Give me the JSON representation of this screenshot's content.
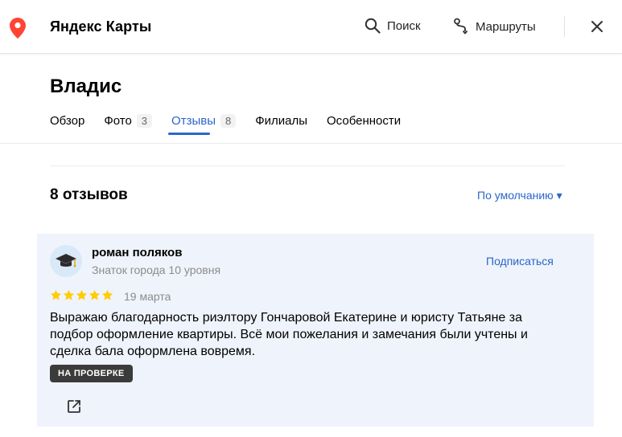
{
  "header": {
    "app_title": "Яндекс Карты",
    "search_label": "Поиск",
    "routes_label": "Маршруты",
    "accent": "#f33"
  },
  "org": {
    "name": "Владис"
  },
  "tabs": [
    {
      "label": "Обзор",
      "count": ""
    },
    {
      "label": "Фото",
      "count": "3"
    },
    {
      "label": "Отзывы",
      "count": "8",
      "active": true
    },
    {
      "label": "Филиалы",
      "count": ""
    },
    {
      "label": "Особенности",
      "count": ""
    }
  ],
  "reviews": {
    "count_label": "8 отзывов",
    "sort_label": "По умолчанию ▾"
  },
  "review": {
    "author": "роман поляков",
    "level": "Знаток города 10 уровня",
    "subscribe_label": "Подписаться",
    "rating": 5,
    "date": "19 марта",
    "text": "Выражаю благодарность риэлтору Гончаровой Екатерине и юристу Татьяне за подбор оформление квартиры. Всё мои пожелания и замечания были учтены и сделка бала оформлена вовремя.",
    "badge": "НА ПРОВЕРКЕ",
    "star_color": "#fc0"
  }
}
